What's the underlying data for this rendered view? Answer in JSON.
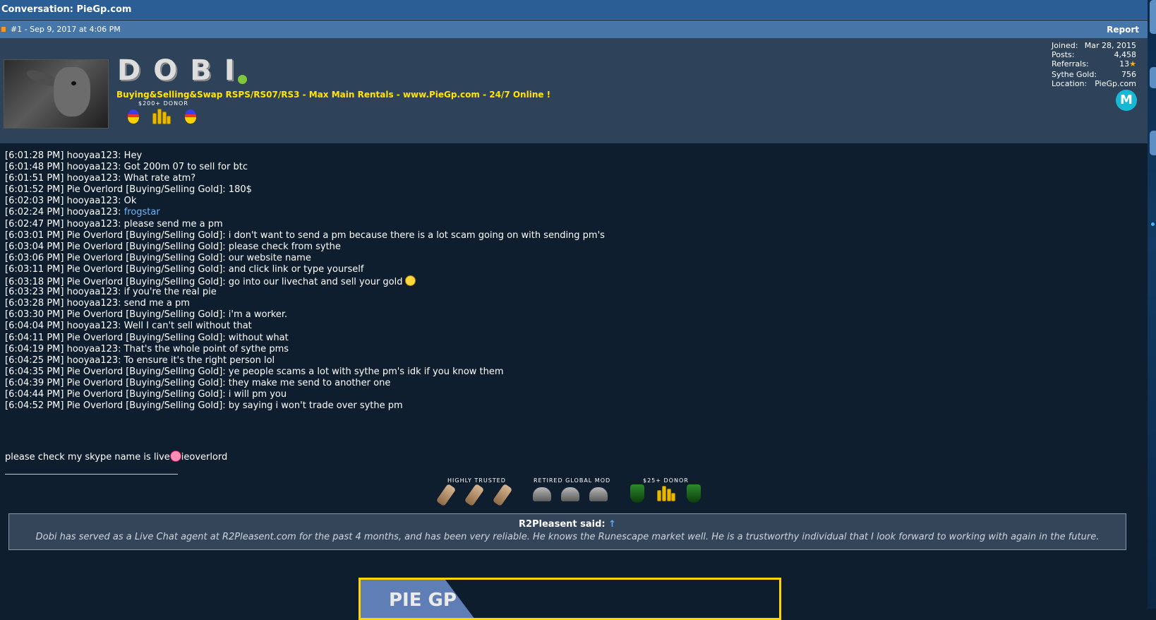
{
  "window": {
    "title": "Conversation: PieGp.com"
  },
  "post": {
    "number_date": "#1 - Sep 9, 2017 at 4:06 PM",
    "report_label": "Report"
  },
  "user": {
    "name": "DOBI",
    "title": "Buying&Selling&Swap RSPS/RS07/RS3 - Max Main Rentals - www.PieGp.com - 24/7 Online !",
    "donor_badge_label": "$200+ DONOR",
    "stats": {
      "joined_label": "Joined:",
      "joined_value": "Mar 28, 2015",
      "posts_label": "Posts:",
      "posts_value": "4,458",
      "referrals_label": "Referrals:",
      "referrals_value": "13",
      "gold_label": "Sythe Gold:",
      "gold_value": "756",
      "location_label": "Location:",
      "location_value": "PieGp.com"
    },
    "m_badge": "M"
  },
  "chat": [
    {
      "text": "[6:01:28 PM] hooyaa123: Hey"
    },
    {
      "text": "[6:01:48 PM] hooyaa123: Got 200m 07 to sell for btc"
    },
    {
      "text": "[6:01:51 PM] hooyaa123: What rate atm?"
    },
    {
      "text": "[6:01:52 PM] Pie Overlord [Buying/Selling Gold]: 180$"
    },
    {
      "text": "[6:02:03 PM] hooyaa123: Ok"
    },
    {
      "text": "[6:02:24 PM] hooyaa123: ",
      "link": "frogstar"
    },
    {
      "text": "[6:02:47 PM] hooyaa123: please send me a pm"
    },
    {
      "text": "[6:03:01 PM] Pie Overlord [Buying/Selling Gold]: i don't want to send a pm because there is a lot scam going on with sending pm's"
    },
    {
      "text": "[6:03:04 PM] Pie Overlord [Buying/Selling Gold]: please check from sythe"
    },
    {
      "text": "[6:03:06 PM] Pie Overlord [Buying/Selling Gold]: our website name"
    },
    {
      "text": "[6:03:11 PM] Pie Overlord [Buying/Selling Gold]: and click link or type yourself"
    },
    {
      "text": "[6:03:18 PM] Pie Overlord [Buying/Selling Gold]: go into our livechat and sell your gold",
      "smiley": true
    },
    {
      "text": "[6:03:23 PM] hooyaa123: if you're the real pie"
    },
    {
      "text": "[6:03:28 PM] hooyaa123: send me a pm"
    },
    {
      "text": "[6:03:30 PM] Pie Overlord [Buying/Selling Gold]: i'm a worker."
    },
    {
      "text": "[6:04:04 PM] hooyaa123: Well I can't sell without that"
    },
    {
      "text": "[6:04:11 PM] Pie Overlord [Buying/Selling Gold]: without what"
    },
    {
      "text": "[6:04:19 PM] hooyaa123: That's the whole point of sythe pms"
    },
    {
      "text": "[6:04:25 PM] hooyaa123: To ensure it's the right person lol"
    },
    {
      "text": "[6:04:35 PM] Pie Overlord [Buying/Selling Gold]: ye people scams a lot with sythe pm's idk if you know them"
    },
    {
      "text": "[6:04:39 PM] Pie Overlord [Buying/Selling Gold]: they make me send to another one"
    },
    {
      "text": "[6:04:44 PM] Pie Overlord [Buying/Selling Gold]: i will pm you"
    },
    {
      "text": "[6:04:52 PM] Pie Overlord [Buying/Selling Gold]: by saying i won't trade over sythe pm"
    }
  ],
  "signature": {
    "text_before": "please check my skype name is live",
    "text_after": "ieoverlord",
    "badges": {
      "trusted": "HIGHLY TRUSTED",
      "retired": "RETIRED GLOBAL MOD",
      "donor": "$25+ DONOR"
    }
  },
  "quote": {
    "header": "R2Pleasent said:",
    "arrow": "↑",
    "body": "Dobi has served as a Live Chat agent at R2Pleasent.com for the past 4 months, and has been very reliable. He knows the Runescape market well. He is a trustworthy individual that I look forward to working with again in the future."
  },
  "banner": {
    "text": "PIE GP"
  },
  "colors": {
    "header_blue": "#2b5e95",
    "title_yellow": "#ffe500",
    "link_blue": "#6ab7ff",
    "online_green": "#7ec63b"
  }
}
